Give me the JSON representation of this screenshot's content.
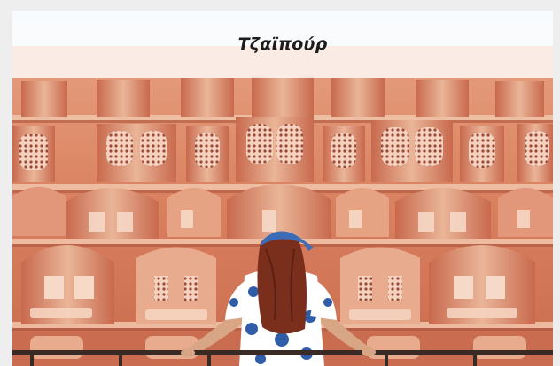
{
  "banner": {
    "title": "Τζαϊπούρ"
  },
  "photo": {
    "subject": "palace-facade-photo"
  },
  "colors": {
    "facade": "#d9805f",
    "facade_light": "#ecb79a",
    "facade_dark": "#b95e44",
    "dress": "#2f5da8",
    "hair": "#7a2e1c"
  }
}
